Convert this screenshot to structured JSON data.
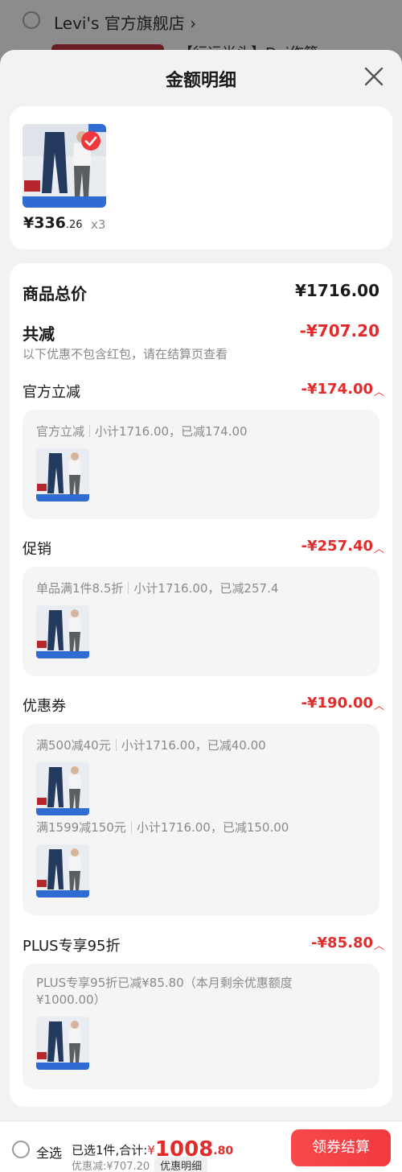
{
  "background": {
    "store_name": "Levi's 官方旗舰店 ›",
    "item_title": "【行运尚头】Dai作籍"
  },
  "sheet": {
    "title": "金额明细"
  },
  "product": {
    "price_int": "¥336",
    "price_dec": ".26",
    "qty": "x3"
  },
  "summary": {
    "total_label": "商品总价",
    "total_value": "¥1716.00",
    "discount_label": "共减",
    "discount_value": "-¥707.20",
    "discount_note": "以下优惠不包含红包，请在结算页查看"
  },
  "sections": [
    {
      "label": "官方立减",
      "value": "-¥174.00",
      "lines": [
        {
          "name": "官方立减",
          "detail": "小计1716.00，已减174.00"
        }
      ]
    },
    {
      "label": "促销",
      "value": "-¥257.40",
      "lines": [
        {
          "name": "单品满1件8.5折",
          "detail": "小计1716.00，已减257.4"
        }
      ]
    },
    {
      "label": "优惠券",
      "value": "-¥190.00",
      "lines": [
        {
          "name": "满500减40元",
          "detail": "小计1716.00，已减40.00"
        },
        {
          "name": "满1599减150元",
          "detail": "小计1716.00，已减150.00"
        }
      ]
    },
    {
      "label": "PLUS专享95折",
      "value": "-¥85.80",
      "lines": [
        {
          "text": "PLUS专享95折已减¥85.80（本月剩余优惠额度¥1000.00）"
        }
      ]
    }
  ],
  "bottom_bar": {
    "select_all": "全选",
    "selected_text": "已选1件,合计:",
    "yen": "¥",
    "total_int": "1008",
    "total_dec": ".80",
    "discount_text": "优惠减:¥707.20",
    "detail_tag": "优惠明细",
    "checkout": "领券结算"
  },
  "colors": {
    "accent_red": "#e22b2b",
    "checkout_bg": "#f23a3f"
  },
  "icons": {
    "close": "close-icon",
    "check": "check-icon",
    "chevron": "chevron-up-icon"
  }
}
